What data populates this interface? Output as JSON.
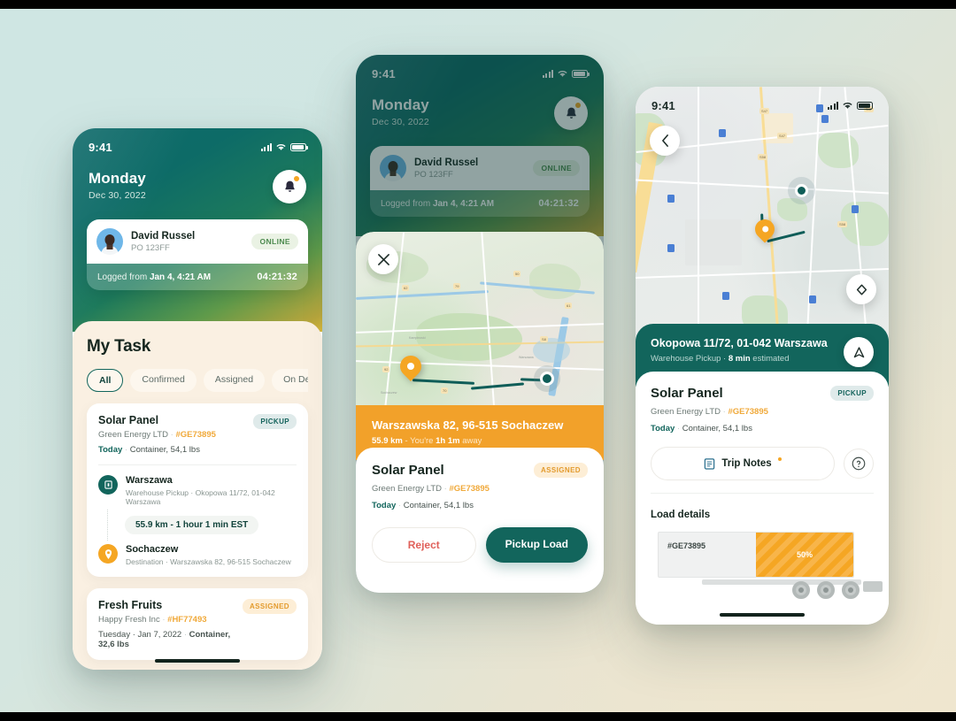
{
  "colors": {
    "teal": "#12655c",
    "orange": "#f2a12a",
    "amber": "#f5a623",
    "reject_red": "#e0605a",
    "cream": "#faf0e2",
    "bg_mint": "#cfe7e4",
    "bg_sand": "#efe7d0"
  },
  "status_bar": {
    "time": "9:41",
    "signal_icon": "signal-icon",
    "wifi_icon": "wifi-icon",
    "battery_icon": "battery-icon"
  },
  "driver": {
    "name": "David Russel",
    "po": "PO 123FF",
    "status": "ONLINE",
    "logged_label": "Logged from",
    "logged_value": "Jan 4, 4:21 AM",
    "elapsed": "04:21:32",
    "avatar_icon": "avatar"
  },
  "header": {
    "day": "Monday",
    "date": "Dec 30, 2022",
    "bell_icon": "bell-icon"
  },
  "screen1": {
    "title": "My Task",
    "filters": [
      {
        "label": "All",
        "selected": true
      },
      {
        "label": "Confirmed",
        "selected": false
      },
      {
        "label": "Assigned",
        "selected": false
      },
      {
        "label": "On Delivery",
        "selected": false
      }
    ],
    "tasks": [
      {
        "title": "Solar Panel",
        "company": "Green Energy LTD",
        "ref": "#GE73895",
        "when": "Today",
        "cargo": "Container, 54,1 lbs",
        "tag": "PICKUP",
        "route": {
          "origin_name": "Warszawa",
          "origin_sub": "Warehouse Pickup · Okopowa 11/72, 01-042 Warszawa",
          "eta": "55.9 km - 1 hour 1 min EST",
          "dest_name": "Sochaczew",
          "dest_sub": "Destination · Warszawska 82, 96-515 Sochaczew"
        }
      },
      {
        "title": "Fresh Fruits",
        "company": "Happy Fresh Inc",
        "ref": "#HF77493",
        "when": "Tuesday · Jan 7, 2022",
        "cargo": "Container, 32,6 lbs",
        "tag": "ASSIGNED"
      }
    ]
  },
  "screen2": {
    "close_icon": "close-icon",
    "destination": {
      "address": "Warszawska 82, 96-515 Sochaczew",
      "distance": "55.9 km",
      "separator": "-",
      "prefix": "You're",
      "time_away": "1h 1m",
      "suffix": "away"
    },
    "load": {
      "title": "Solar Panel",
      "company": "Green Energy LTD",
      "ref": "#GE73895",
      "when": "Today",
      "cargo": "Container, 54,1 lbs",
      "tag": "ASSIGNED"
    },
    "buttons": {
      "reject": "Reject",
      "pickup": "Pickup Load"
    }
  },
  "screen3": {
    "back_icon": "chevron-left-icon",
    "locate_icon": "locate-icon",
    "navigate_icon": "navigate-arrow-icon",
    "pickup_bar": {
      "address": "Okopowa 11/72, 01-042 Warszawa",
      "type": "Warehouse Pickup",
      "separator": "·",
      "eta_value": "8 min",
      "eta_suffix": "estimated"
    },
    "load": {
      "title": "Solar Panel",
      "company": "Green Energy LTD",
      "ref": "#GE73895",
      "when": "Today",
      "cargo": "Container, 54,1 lbs",
      "tag": "PICKUP"
    },
    "trip_notes_label": "Trip Notes",
    "trip_notes_icon": "notes-icon",
    "help_icon": "help-icon",
    "load_details_title": "Load details",
    "truck": {
      "ref": "#GE73895",
      "fill_percent": "50%"
    }
  }
}
